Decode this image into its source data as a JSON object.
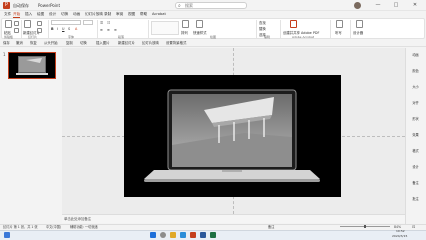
{
  "title_bar": {
    "logo": "P",
    "autosave": "自动保存",
    "doc_title": "PowerPoint",
    "search_placeholder": "搜索",
    "window_controls": [
      "—",
      "□",
      "✕"
    ]
  },
  "menu_tabs": [
    "文件",
    "开始",
    "插入",
    "绘图",
    "设计",
    "切换",
    "动画",
    "幻灯片放映",
    "录制",
    "审阅",
    "视图",
    "帮助",
    "Acrobat"
  ],
  "active_tab": "开始",
  "ribbon": {
    "paste": "粘贴",
    "new_slide": "新建幻灯片",
    "groups": [
      "剪贴板",
      "幻灯片",
      "字体",
      "段落",
      "绘图",
      "编辑",
      "Adobe Acrobat"
    ],
    "arrange": "排列",
    "quick_styles": "快速样式",
    "find": "查找",
    "replace": "替换",
    "select": "选择",
    "adobe": "创建并共享 Adobe PDF",
    "voice": "听写",
    "designer": "设计器"
  },
  "quick_access": [
    "保存",
    "撤消",
    "恢复",
    "从头开始",
    "复制",
    "切换",
    "插入图片",
    "新建幻灯片",
    "幻灯片放映",
    "设置背景格式"
  ],
  "thumbnail": {
    "number": "1"
  },
  "notes_placeholder": "单击此处添加备注",
  "right_sidebar": [
    "动画",
    "颜色",
    "大小",
    "对齐",
    "形状",
    "效果",
    "格式",
    "设计",
    "备注",
    "批注"
  ],
  "status_bar": {
    "slide_info": "幻灯片 第 1 张，共 1 张",
    "language": "中文(中国)",
    "accessibility": "辅助功能: 一切就绪",
    "notes": "备注",
    "zoom": "84%"
  },
  "taskbar": {
    "time": "10:52",
    "date": "2024/3/15"
  },
  "colors": {
    "accent": "#c43e1c"
  }
}
